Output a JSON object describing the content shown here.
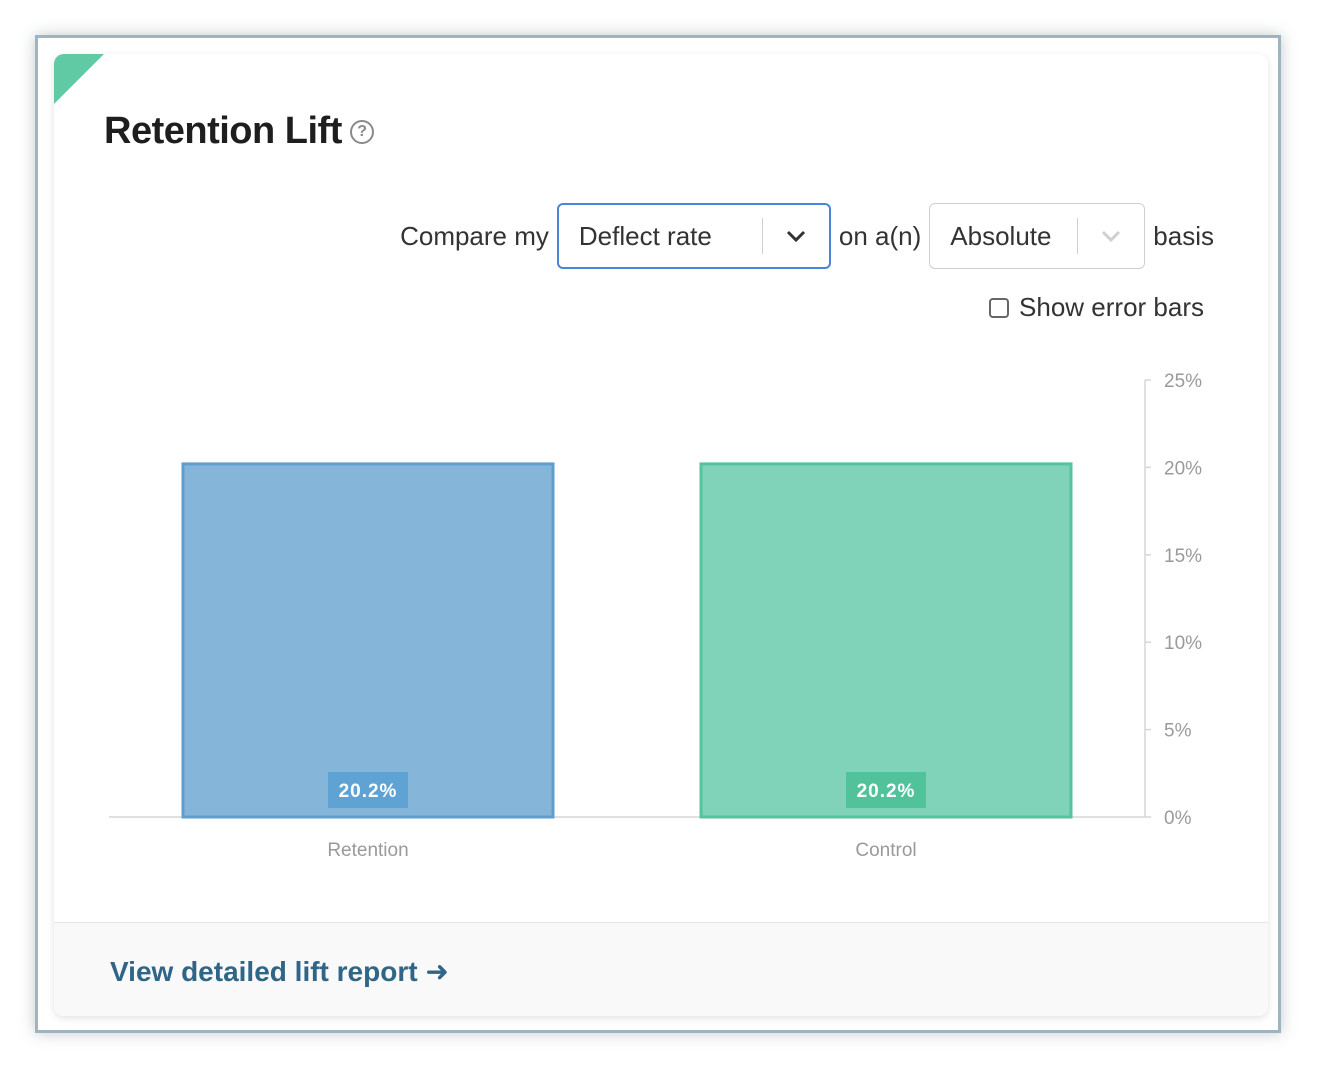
{
  "card": {
    "title": "Retention Lift"
  },
  "controls": {
    "prefix": "Compare my",
    "metric_value": "Deflect rate",
    "connector": "on a(n)",
    "basis_value": "Absolute",
    "suffix": "basis",
    "error_bars_label": "Show error bars",
    "error_bars_checked": false
  },
  "footer": {
    "link_label": "View detailed lift report ➜"
  },
  "colors": {
    "retention": "#85b6da",
    "control": "#80d3b8",
    "accent": "#5fcaa4"
  },
  "chart_data": {
    "type": "bar",
    "categories": [
      "Retention",
      "Control"
    ],
    "values": [
      20.2,
      20.2
    ],
    "value_labels": [
      "20.2%",
      "20.2%"
    ],
    "ylim": [
      0,
      25
    ],
    "yticks": [
      0,
      5,
      10,
      15,
      20,
      25
    ],
    "ytick_labels": [
      "0%",
      "5%",
      "10%",
      "15%",
      "20%",
      "25%"
    ],
    "y_axis_side": "right",
    "grid": false
  }
}
